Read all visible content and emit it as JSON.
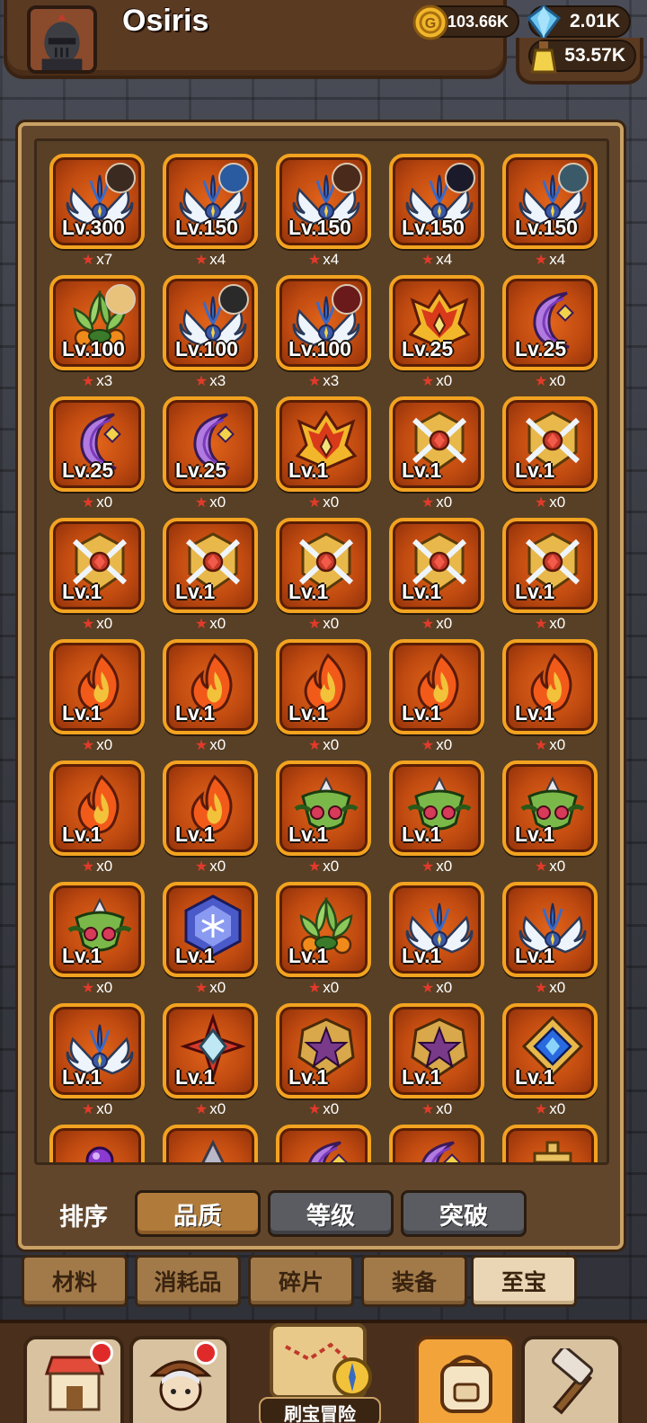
{
  "player": {
    "name": "Osiris",
    "gold": "103.66K",
    "gems": "2.01K",
    "potion": "53.57K"
  },
  "items": [
    {
      "art": "wing-blue",
      "level": "Lv.300",
      "stars": "x7",
      "hero": true
    },
    {
      "art": "wing-blue",
      "level": "Lv.150",
      "stars": "x4",
      "hero": true
    },
    {
      "art": "wing-blue",
      "level": "Lv.150",
      "stars": "x4",
      "hero": true
    },
    {
      "art": "wing-blue",
      "level": "Lv.150",
      "stars": "x4",
      "hero": true
    },
    {
      "art": "wing-blue",
      "level": "Lv.150",
      "stars": "x4",
      "hero": true
    },
    {
      "art": "leaf-green",
      "level": "Lv.100",
      "stars": "x3",
      "hero": true
    },
    {
      "art": "wing-blue",
      "level": "Lv.100",
      "stars": "x3",
      "hero": true
    },
    {
      "art": "wing-blue",
      "level": "Lv.100",
      "stars": "x3",
      "hero": true
    },
    {
      "art": "flame-crest",
      "level": "Lv.25",
      "stars": "x0",
      "hero": false
    },
    {
      "art": "moon-purple",
      "level": "Lv.25",
      "stars": "x0",
      "hero": false
    },
    {
      "art": "moon-purple",
      "level": "Lv.25",
      "stars": "x0",
      "hero": false
    },
    {
      "art": "moon-purple",
      "level": "Lv.25",
      "stars": "x0",
      "hero": false
    },
    {
      "art": "flame-crest",
      "level": "Lv.1",
      "stars": "x0",
      "hero": false
    },
    {
      "art": "gold-shield",
      "level": "Lv.1",
      "stars": "x0",
      "hero": false
    },
    {
      "art": "gold-shield",
      "level": "Lv.1",
      "stars": "x0",
      "hero": false
    },
    {
      "art": "gold-shield",
      "level": "Lv.1",
      "stars": "x0",
      "hero": false
    },
    {
      "art": "gold-shield",
      "level": "Lv.1",
      "stars": "x0",
      "hero": false
    },
    {
      "art": "gold-shield",
      "level": "Lv.1",
      "stars": "x0",
      "hero": false
    },
    {
      "art": "gold-shield",
      "level": "Lv.1",
      "stars": "x0",
      "hero": false
    },
    {
      "art": "gold-shield",
      "level": "Lv.1",
      "stars": "x0",
      "hero": false
    },
    {
      "art": "fire",
      "level": "Lv.1",
      "stars": "x0",
      "hero": false
    },
    {
      "art": "fire",
      "level": "Lv.1",
      "stars": "x0",
      "hero": false
    },
    {
      "art": "fire",
      "level": "Lv.1",
      "stars": "x0",
      "hero": false
    },
    {
      "art": "fire",
      "level": "Lv.1",
      "stars": "x0",
      "hero": false
    },
    {
      "art": "fire",
      "level": "Lv.1",
      "stars": "x0",
      "hero": false
    },
    {
      "art": "fire",
      "level": "Lv.1",
      "stars": "x0",
      "hero": false
    },
    {
      "art": "fire",
      "level": "Lv.1",
      "stars": "x0",
      "hero": false
    },
    {
      "art": "green-beast",
      "level": "Lv.1",
      "stars": "x0",
      "hero": false
    },
    {
      "art": "green-beast",
      "level": "Lv.1",
      "stars": "x0",
      "hero": false
    },
    {
      "art": "green-beast",
      "level": "Lv.1",
      "stars": "x0",
      "hero": false
    },
    {
      "art": "green-beast",
      "level": "Lv.1",
      "stars": "x0",
      "hero": false
    },
    {
      "art": "snowflake-hex",
      "level": "Lv.1",
      "stars": "x0",
      "hero": false
    },
    {
      "art": "leaf-green",
      "level": "Lv.1",
      "stars": "x0",
      "hero": false
    },
    {
      "art": "wing-blue",
      "level": "Lv.1",
      "stars": "x0",
      "hero": false
    },
    {
      "art": "wing-blue",
      "level": "Lv.1",
      "stars": "x0",
      "hero": false
    },
    {
      "art": "wing-blue",
      "level": "Lv.1",
      "stars": "x0",
      "hero": false
    },
    {
      "art": "star-compass",
      "level": "Lv.1",
      "stars": "x0",
      "hero": false
    },
    {
      "art": "purple-star",
      "level": "Lv.1",
      "stars": "x0",
      "hero": false
    },
    {
      "art": "purple-star",
      "level": "Lv.1",
      "stars": "x0",
      "hero": false
    },
    {
      "art": "blue-diamond",
      "level": "Lv.1",
      "stars": "x0",
      "hero": false
    },
    {
      "art": "purple-orb",
      "level": "",
      "stars": "",
      "hero": false
    },
    {
      "art": "spike",
      "level": "",
      "stars": "",
      "hero": false
    },
    {
      "art": "moon-purple",
      "level": "",
      "stars": "",
      "hero": false
    },
    {
      "art": "moon-purple",
      "level": "",
      "stars": "",
      "hero": false
    },
    {
      "art": "gold-cross",
      "level": "",
      "stars": "",
      "hero": false
    }
  ],
  "sort": {
    "label": "排序",
    "options": [
      "品质",
      "等级",
      "突破"
    ],
    "active": "品质"
  },
  "tabs": [
    "材料",
    "消耗品",
    "碎片",
    "装备",
    "至宝"
  ],
  "selected_tab": "至宝",
  "nav": {
    "adventure_label": "刷宝冒险"
  }
}
